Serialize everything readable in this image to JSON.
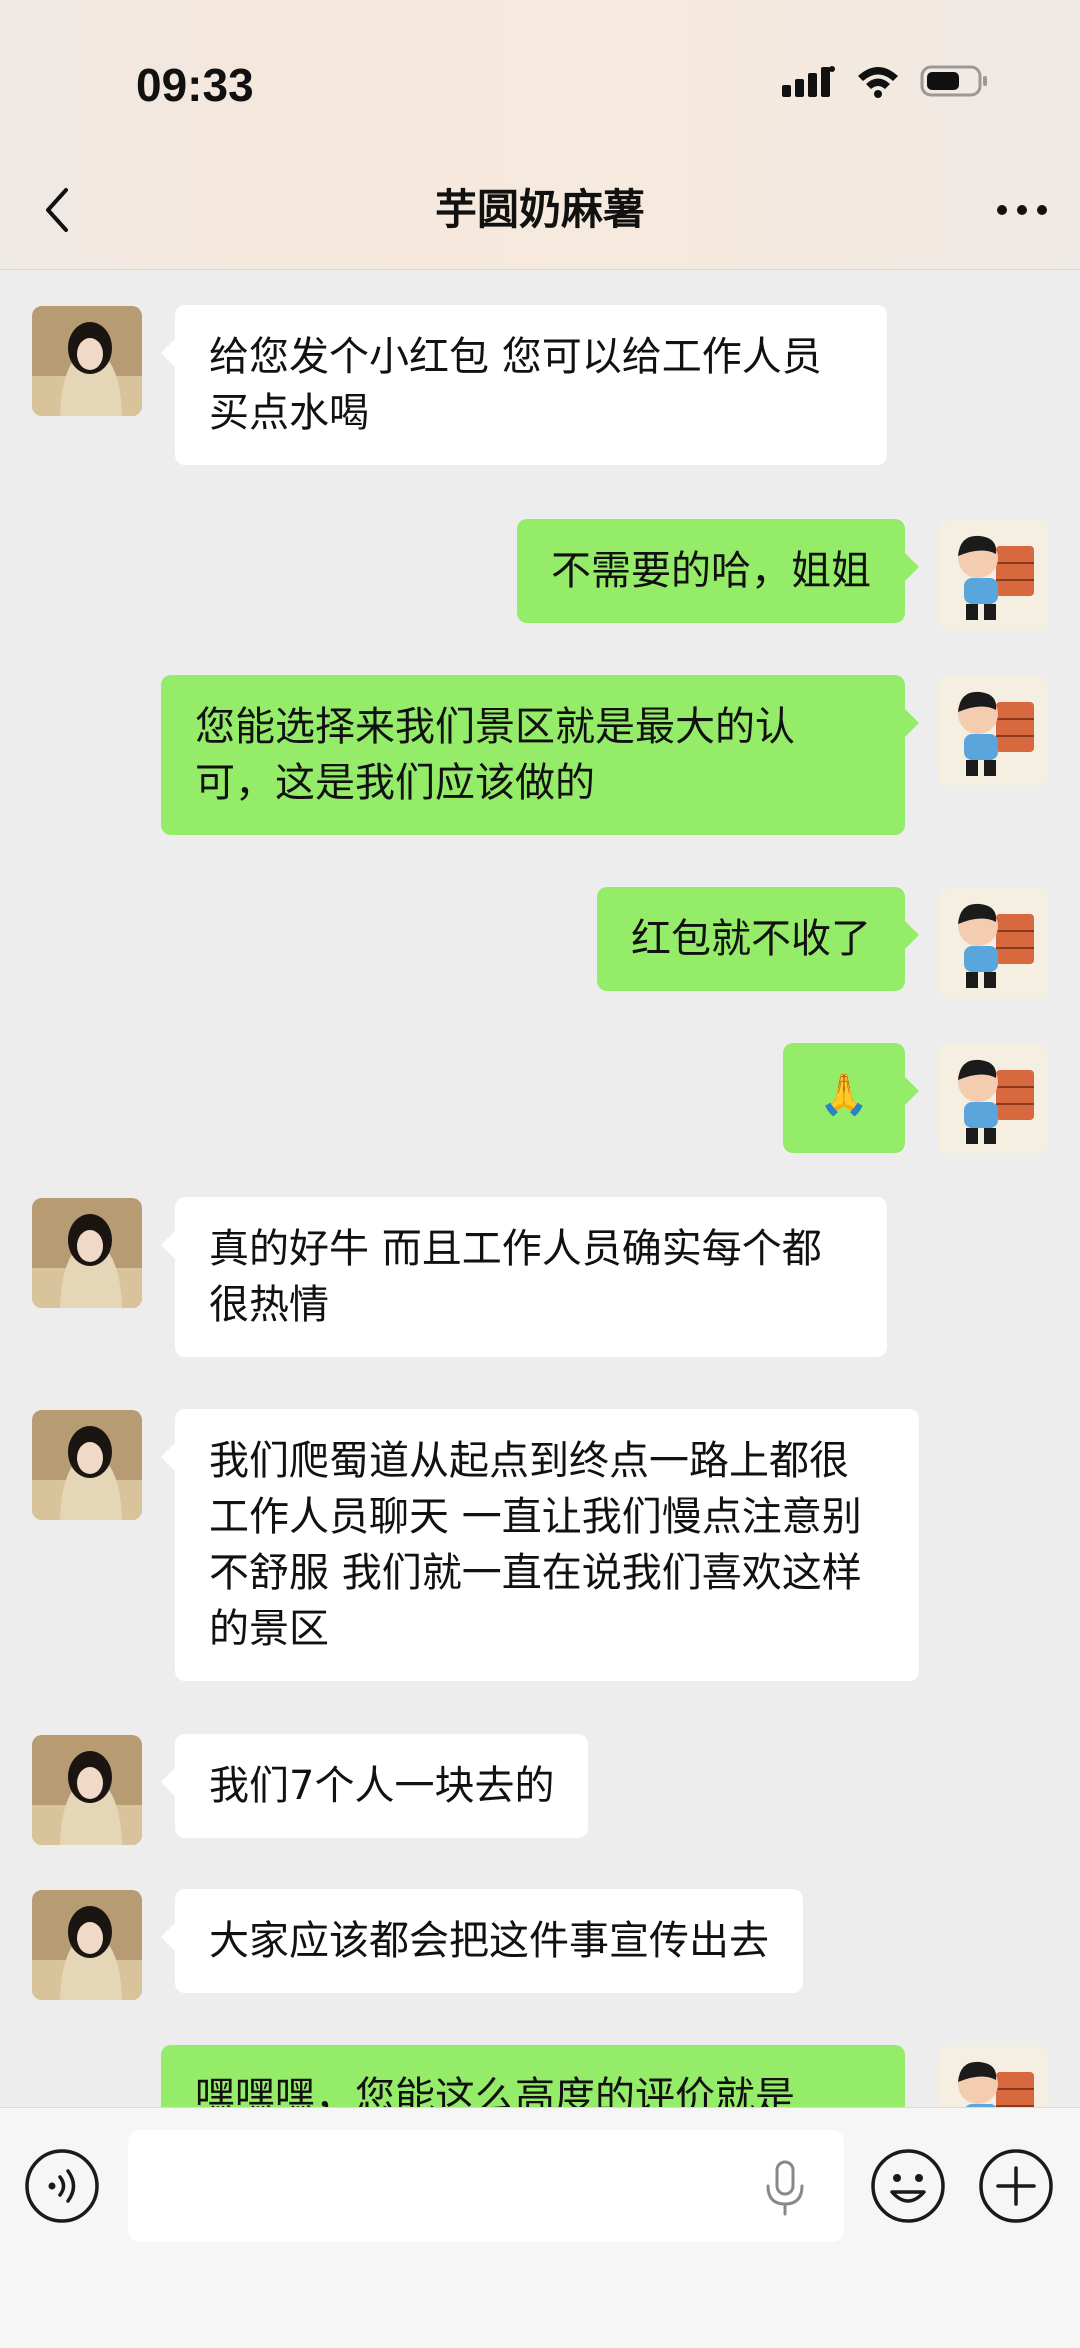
{
  "status_bar": {
    "time": "09:33"
  },
  "nav": {
    "title": "芋圆奶麻薯"
  },
  "messages": [
    {
      "side": "left",
      "text": "给您发个小红包 您可以给工作人员买点水喝"
    },
    {
      "side": "right",
      "text": "不需要的哈，姐姐"
    },
    {
      "side": "right",
      "text": "您能选择来我们景区就是最大的认可，这是我们应该做的"
    },
    {
      "side": "right",
      "text": "红包就不收了"
    },
    {
      "side": "right",
      "text": "🙏"
    },
    {
      "side": "left",
      "text": "真的好牛 而且工作人员确实每个都很热情"
    },
    {
      "side": "left",
      "text": "我们爬蜀道从起点到终点一路上都很工作人员聊天 一直让我们慢点注意别不舒服 我们就一直在说我们喜欢这样的景区"
    },
    {
      "side": "left",
      "text": "我们7个人一块去的"
    },
    {
      "side": "left",
      "text": "大家应该都会把这件事宣传出去"
    },
    {
      "side": "right",
      "text": "嘿嘿嘿，您能这么高度的评价就是"
    }
  ],
  "input": {
    "value": "",
    "placeholder": ""
  },
  "icons": {
    "back": "chevron-left-icon",
    "more": "more-dots-icon",
    "voice": "voice-icon",
    "mic": "mic-icon",
    "emoji": "emoji-icon",
    "plus": "plus-icon"
  },
  "colors": {
    "sent_bubble": "#95ec69",
    "received_bubble": "#ffffff",
    "background": "#ededed"
  }
}
